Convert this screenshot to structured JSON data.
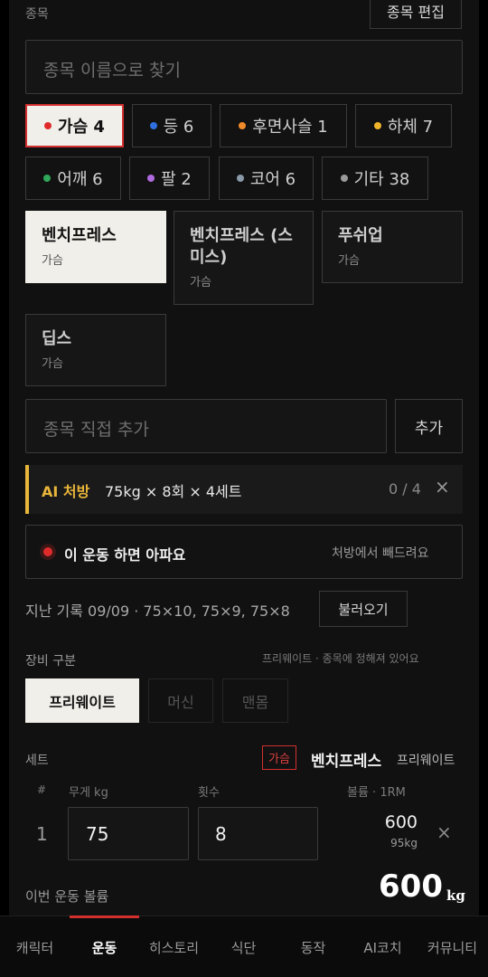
{
  "header": {
    "section_label": "종목",
    "edit_button": "종목 편집"
  },
  "search": {
    "placeholder": "종목 이름으로 찾기"
  },
  "categories": [
    {
      "label": "가슴 4",
      "color": "#e02b2b",
      "active": true
    },
    {
      "label": "등 6",
      "color": "#2f6fe0"
    },
    {
      "label": "후면사슬 1",
      "color": "#f08a2a"
    },
    {
      "label": "하체 7",
      "color": "#f0b42a"
    },
    {
      "label": "어깨 6",
      "color": "#2fa85a"
    },
    {
      "label": "팔 2",
      "color": "#b06ae0"
    },
    {
      "label": "코어 6",
      "color": "#8a9aa8"
    },
    {
      "label": "기타 38",
      "color": "#9a9a9a"
    }
  ],
  "exercises": [
    {
      "title": "벤치프레스",
      "sub": "가슴",
      "selected": true
    },
    {
      "title": "벤치프레스 (스미스)",
      "sub": "가슴"
    },
    {
      "title": "푸쉬업",
      "sub": "가슴"
    },
    {
      "title": "딥스",
      "sub": "가슴"
    }
  ],
  "custom_add": {
    "placeholder": "종목 직접 추가",
    "button": "추가"
  },
  "ai_prescription": {
    "badge": "AI 처방",
    "text": "75kg × 8회 × 4세트",
    "progress": "0 / 4",
    "close": "×"
  },
  "pain": {
    "label": "이 운동 하면 아파요",
    "action": "처방에서 빼드려요"
  },
  "history": {
    "text": "지난 기록 09/09 · 75×10, 75×9, 75×8",
    "load_button": "불러오기"
  },
  "equipment": {
    "label": "장비 구분",
    "note": "프리웨이트 · 종목에 정해져 있어요",
    "options": [
      "프리웨이트",
      "머신",
      "맨몸"
    ]
  },
  "sets": {
    "label": "세트",
    "tag": "가슴",
    "exercise": "벤치프레스",
    "equipment": "프리웨이트",
    "columns": {
      "num": "#",
      "weight": "무게 kg",
      "reps": "횟수",
      "volume": "볼륨 · 1RM"
    },
    "rows": [
      {
        "num": "1",
        "weight": "75",
        "reps": "8",
        "volume": "600",
        "orm": "95kg",
        "remove": "×"
      }
    ],
    "total_label": "이번 운동 볼륨",
    "total_value": "600",
    "total_unit": "kg"
  },
  "nav": [
    "캐릭터",
    "운동",
    "히스토리",
    "식단",
    "동작",
    "AI코치",
    "커뮤니티"
  ],
  "nav_active": "운동"
}
